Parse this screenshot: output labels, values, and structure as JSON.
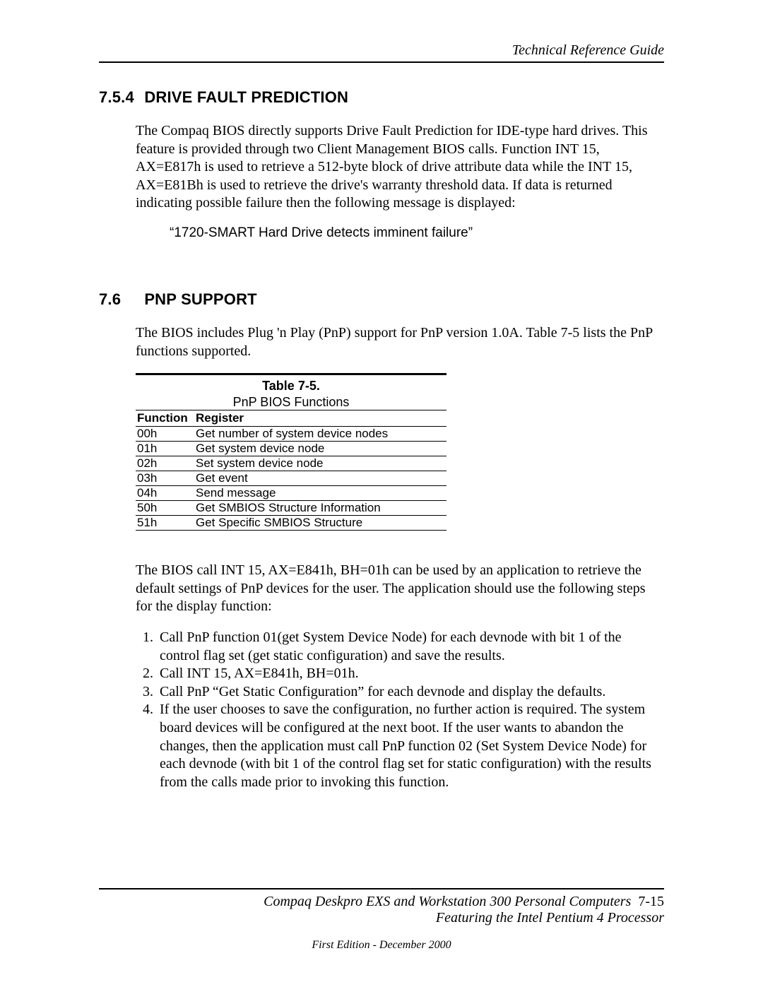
{
  "header": {
    "title": "Technical Reference Guide"
  },
  "section_754": {
    "number": "7.5.4",
    "title": "DRIVE FAULT PREDICTION",
    "paragraph": "The Compaq BIOS directly supports Drive Fault Prediction for IDE-type hard drives. This feature is provided through two Client Management BIOS calls. Function INT 15, AX=E817h is used to retrieve a 512-byte block of drive attribute data while the INT 15, AX=E81Bh is used to retrieve the drive's warranty threshold data.  If data is returned indicating possible failure then the following message is displayed:",
    "quoted": "“1720-SMART Hard Drive detects imminent failure”"
  },
  "section_76": {
    "number": "7.6",
    "title": "PNP SUPPORT",
    "paragraph": "The BIOS includes Plug 'n Play (PnP) support for PnP version 1.0A. Table 7-5 lists the PnP functions supported.",
    "table": {
      "label": "Table 7-5.",
      "subtitle": "PnP BIOS Functions",
      "col_fn": "Function",
      "col_reg": "Register",
      "rows": [
        {
          "fn": "00h",
          "reg": "Get number of system device nodes"
        },
        {
          "fn": "01h",
          "reg": "Get system device node"
        },
        {
          "fn": "02h",
          "reg": "Set system device node"
        },
        {
          "fn": "03h",
          "reg": "Get event"
        },
        {
          "fn": "04h",
          "reg": "Send message"
        },
        {
          "fn": "50h",
          "reg": "Get SMBIOS Structure Information"
        },
        {
          "fn": "51h",
          "reg": "Get Specific SMBIOS Structure"
        }
      ]
    },
    "paragraph2": "The BIOS call INT 15, AX=E841h, BH=01h can be used by an application to retrieve the default settings of PnP devices for the user. The application should use the following steps for the display function:",
    "steps": [
      "Call PnP function 01(get System Device Node) for each devnode with bit 1 of the control flag set (get static configuration) and save the results.",
      "Call INT 15, AX=E841h, BH=01h.",
      "Call PnP “Get Static Configuration” for each devnode and display the defaults.",
      "If the user chooses to save the configuration, no further action is required. The system board devices will be configured at the next boot. If the user wants to abandon the changes, then the application must call PnP function 02 (Set System Device Node) for each devnode (with bit 1 of the control flag set for static configuration) with the results from the calls made prior to invoking this function."
    ]
  },
  "footer": {
    "line1_title": "Compaq Deskpro EXS and Workstation 300 Personal Computers",
    "page_num": "7-15",
    "line2": "Featuring the Intel Pentium 4 Processor",
    "line3": "First Edition - December 2000"
  }
}
